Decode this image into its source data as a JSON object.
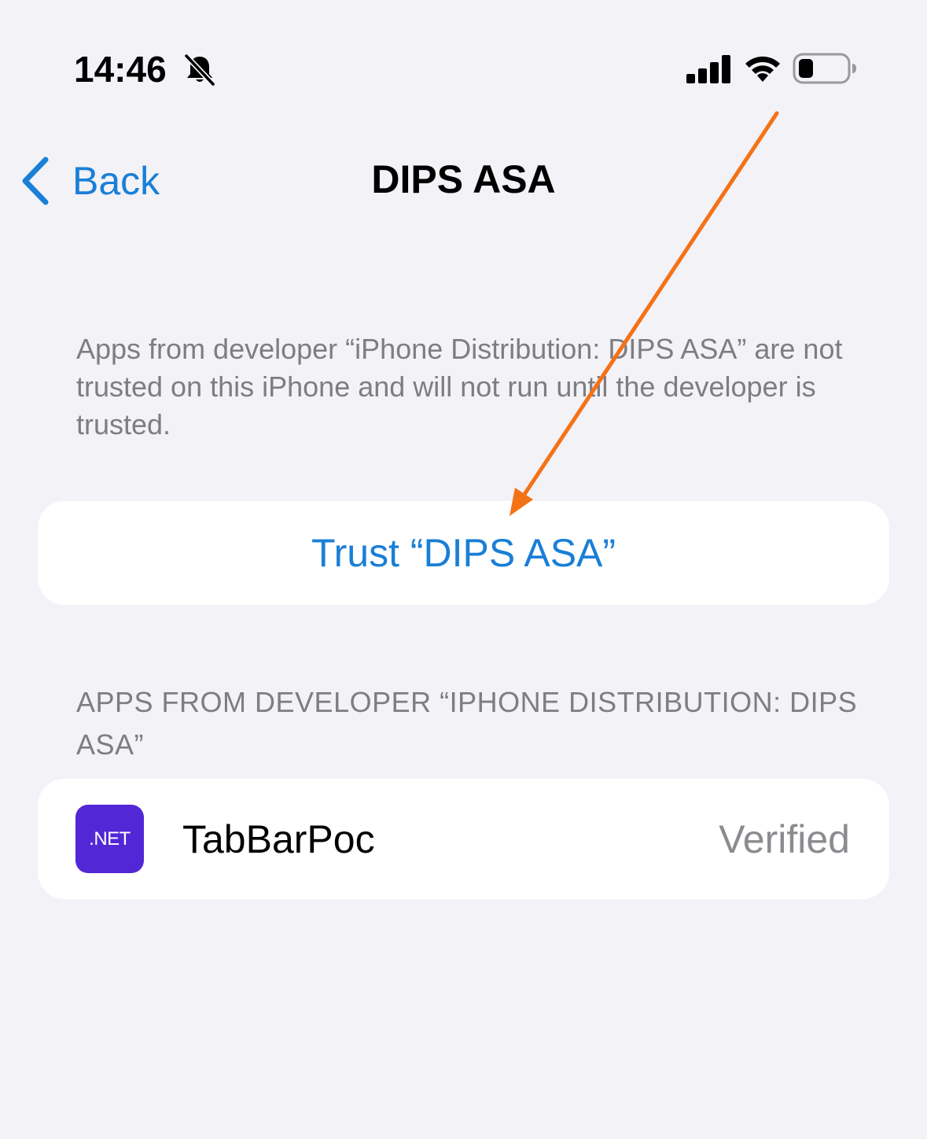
{
  "status_bar": {
    "time": "14:46",
    "bell_icon": "bell-slash-icon",
    "signal_icon": "cellular-signal-icon",
    "wifi_icon": "wifi-icon",
    "battery_icon": "battery-icon"
  },
  "nav": {
    "back_label": "Back",
    "back_icon": "chevron-left-icon",
    "title": "DIPS ASA"
  },
  "description": "Apps from developer “iPhone Distribution: DIPS ASA” are not trusted on this iPhone and will not run until the developer is trusted.",
  "trust_button": {
    "label": "Trust “DIPS ASA”"
  },
  "apps_section": {
    "header": "APPS FROM DEVELOPER “IPHONE DISTRIBUTION: DIPS ASA”",
    "items": [
      {
        "icon_label": ".NET",
        "name": "TabBarPoc",
        "status": "Verified"
      }
    ]
  },
  "colors": {
    "accent": "#1a7fd6",
    "background": "#f2f2f7",
    "secondary_text": "#7d7d82",
    "dotnet_purple": "#5227d5",
    "annotation_arrow": "#f47216"
  }
}
